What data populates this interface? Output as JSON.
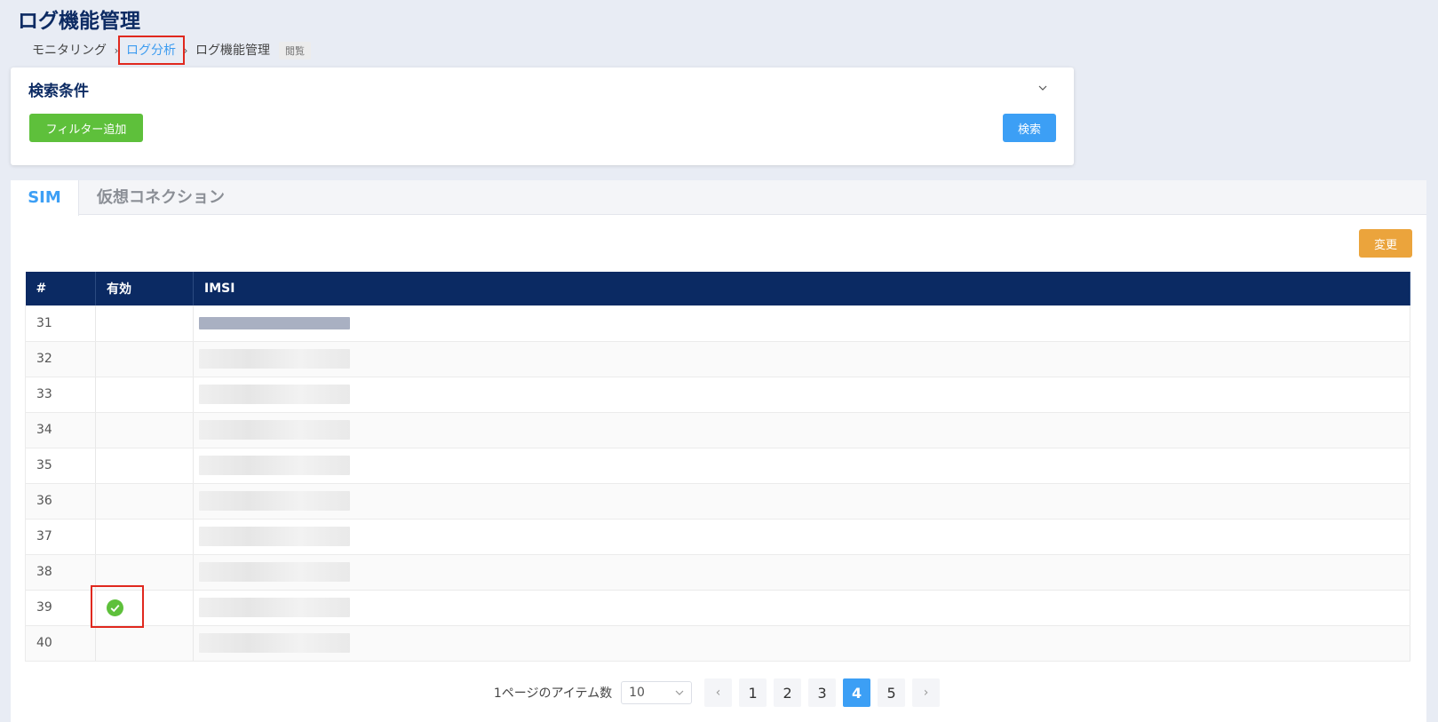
{
  "page": {
    "title": "ログ機能管理"
  },
  "breadcrumb": {
    "items": [
      "モニタリング",
      "ログ分析",
      "ログ機能管理"
    ],
    "badge": "閲覧"
  },
  "search": {
    "title": "検索条件",
    "add_filter_label": "フィルター追加",
    "search_label": "検索"
  },
  "tabs": [
    {
      "label": "SIM",
      "active": true
    },
    {
      "label": "仮想コネクション",
      "active": false
    }
  ],
  "toolbar": {
    "change_label": "変更"
  },
  "table": {
    "headers": [
      "#",
      "有効",
      "IMSI"
    ],
    "rows": [
      {
        "num": "31",
        "valid": false
      },
      {
        "num": "32",
        "valid": false
      },
      {
        "num": "33",
        "valid": false
      },
      {
        "num": "34",
        "valid": false
      },
      {
        "num": "35",
        "valid": false
      },
      {
        "num": "36",
        "valid": false
      },
      {
        "num": "37",
        "valid": false
      },
      {
        "num": "38",
        "valid": false
      },
      {
        "num": "39",
        "valid": true
      },
      {
        "num": "40",
        "valid": false
      }
    ]
  },
  "pagination": {
    "items_per_page_label": "1ページのアイテム数",
    "page_size": "10",
    "pages": [
      "1",
      "2",
      "3",
      "4",
      "5"
    ],
    "current_page": "4"
  },
  "colors": {
    "primary": "#3c9ff5",
    "success": "#5ec03b",
    "warning": "#eba43c",
    "header_navy": "#0b2a63",
    "highlight_red": "#e0281e"
  }
}
